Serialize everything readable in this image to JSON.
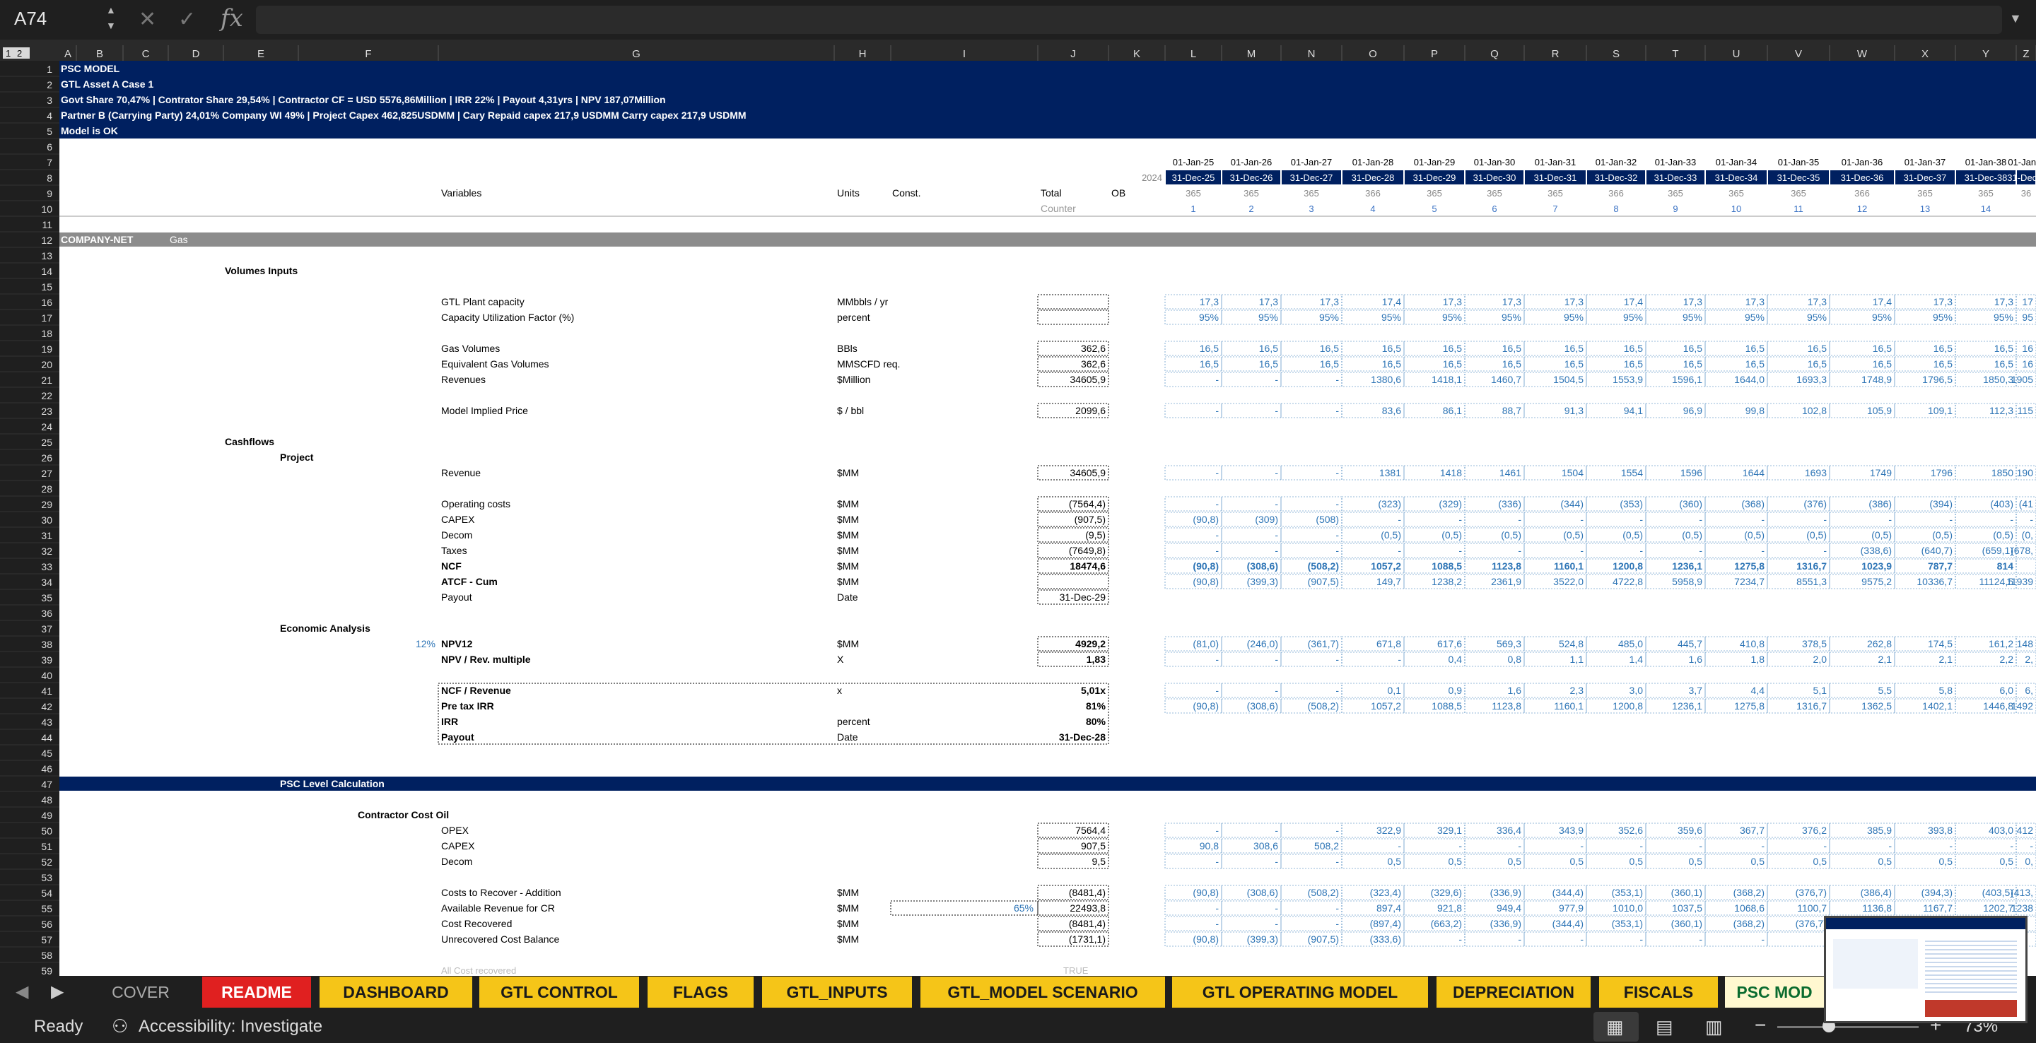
{
  "cell_ref": "A74",
  "formula": "",
  "outline_levels": [
    "1",
    "2"
  ],
  "columns": [
    "A",
    "B",
    "C",
    "D",
    "E",
    "F",
    "G",
    "H",
    "I",
    "J",
    "K",
    "L",
    "M",
    "N",
    "O",
    "P",
    "Q",
    "R",
    "S",
    "T",
    "U",
    "V",
    "W",
    "X",
    "Y",
    "Z"
  ],
  "banner": [
    "PSC MODEL",
    "GTL Asset A Case 1",
    "Govt Share 70,47% | Contrator Share 29,54% | Contractor CF = USD 5576,86Million | IRR 22% | Payout 4,31yrs | NPV 187,07Million",
    "Partner B (Carrying Party) 24,01% Company WI 49% | Project Capex 462,825USDMM | Cary Repaid capex 217,9 USDMM Carry capex 217,9 USDMM",
    "Model is OK"
  ],
  "headers": {
    "start_dates": [
      "01-Jan-25",
      "01-Jan-26",
      "01-Jan-27",
      "01-Jan-28",
      "01-Jan-29",
      "01-Jan-30",
      "01-Jan-31",
      "01-Jan-32",
      "01-Jan-33",
      "01-Jan-34",
      "01-Jan-35",
      "01-Jan-36",
      "01-Jan-37",
      "01-Jan-38",
      "01-Jan-3"
    ],
    "end_dates": [
      "31-Dec-25",
      "31-Dec-26",
      "31-Dec-27",
      "31-Dec-28",
      "31-Dec-29",
      "31-Dec-30",
      "31-Dec-31",
      "31-Dec-32",
      "31-Dec-33",
      "31-Dec-34",
      "31-Dec-35",
      "31-Dec-36",
      "31-Dec-37",
      "31-Dec-38",
      "31-Dec-3"
    ],
    "year_label": "2024",
    "days": [
      "365",
      "365",
      "365",
      "366",
      "365",
      "365",
      "365",
      "366",
      "365",
      "365",
      "365",
      "366",
      "365",
      "365",
      "36"
    ],
    "counter": [
      "1",
      "2",
      "3",
      "4",
      "5",
      "6",
      "7",
      "8",
      "9",
      "10",
      "11",
      "12",
      "13",
      "14",
      ""
    ],
    "variables": "Variables",
    "units": "Units",
    "const": "Const.",
    "total": "Total",
    "ob": "OB",
    "counter_label": "Counter"
  },
  "section": {
    "left": "COMPANY-NET",
    "right": "Gas"
  },
  "labels": {
    "volumes_inputs": "Volumes Inputs",
    "cashflows": "Cashflows",
    "project": "Project",
    "economic_analysis": "Economic Analysis",
    "discount_rate": "12%",
    "psc_level": "PSC Level Calculation",
    "contractor_cost_oil": "Contractor Cost Oil",
    "cost_recovered_note": "All Cost recovered",
    "true_flag": "TRUE",
    "cr_pct": "65%"
  },
  "rows": [
    {
      "r": 16,
      "label": "GTL Plant capacity",
      "unit": "MMbbls / yr",
      "total": "",
      "vals": [
        "17,3",
        "17,3",
        "17,3",
        "17,4",
        "17,3",
        "17,3",
        "17,3",
        "17,4",
        "17,3",
        "17,3",
        "17,3",
        "17,4",
        "17,3",
        "17,3",
        "17"
      ]
    },
    {
      "r": 17,
      "label": "Capacity Utilization Factor (%)",
      "unit": "percent",
      "total": "",
      "vals": [
        "95%",
        "95%",
        "95%",
        "95%",
        "95%",
        "95%",
        "95%",
        "95%",
        "95%",
        "95%",
        "95%",
        "95%",
        "95%",
        "95%",
        "95"
      ]
    },
    {
      "r": 19,
      "label": "Gas Volumes",
      "unit": "BBls",
      "total": "362,6",
      "vals": [
        "16,5",
        "16,5",
        "16,5",
        "16,5",
        "16,5",
        "16,5",
        "16,5",
        "16,5",
        "16,5",
        "16,5",
        "16,5",
        "16,5",
        "16,5",
        "16,5",
        "16"
      ]
    },
    {
      "r": 20,
      "label": "Equivalent Gas Volumes",
      "unit": "MMSCFD req.",
      "total": "362,6",
      "vals": [
        "16,5",
        "16,5",
        "16,5",
        "16,5",
        "16,5",
        "16,5",
        "16,5",
        "16,5",
        "16,5",
        "16,5",
        "16,5",
        "16,5",
        "16,5",
        "16,5",
        "16"
      ]
    },
    {
      "r": 21,
      "label": "Revenues",
      "unit": "$Million",
      "total": "34605,9",
      "vals": [
        "-",
        "-",
        "-",
        "1380,6",
        "1418,1",
        "1460,7",
        "1504,5",
        "1553,9",
        "1596,1",
        "1644,0",
        "1693,3",
        "1748,9",
        "1796,5",
        "1850,3",
        "1905"
      ]
    },
    {
      "r": 23,
      "label": "Model Implied Price",
      "unit": "$ / bbl",
      "total": "2099,6",
      "vals": [
        "-",
        "-",
        "-",
        "83,6",
        "86,1",
        "88,7",
        "91,3",
        "94,1",
        "96,9",
        "99,8",
        "102,8",
        "105,9",
        "109,1",
        "112,3",
        "115"
      ]
    },
    {
      "r": 27,
      "label": "Revenue",
      "unit": "$MM",
      "total": "34605,9",
      "vals": [
        "-",
        "-",
        "-",
        "1381",
        "1418",
        "1461",
        "1504",
        "1554",
        "1596",
        "1644",
        "1693",
        "1749",
        "1796",
        "1850",
        "190"
      ]
    },
    {
      "r": 29,
      "label": "Operating costs",
      "unit": "$MM",
      "total": "(7564,4)",
      "vals": [
        "-",
        "-",
        "-",
        "(323)",
        "(329)",
        "(336)",
        "(344)",
        "(353)",
        "(360)",
        "(368)",
        "(376)",
        "(386)",
        "(394)",
        "(403)",
        "(41"
      ]
    },
    {
      "r": 30,
      "label": "CAPEX",
      "unit": "$MM",
      "total": "(907,5)",
      "vals": [
        "(90,8)",
        "(309)",
        "(508)",
        "-",
        "-",
        "-",
        "-",
        "-",
        "-",
        "-",
        "-",
        "-",
        "-",
        "-",
        "-"
      ]
    },
    {
      "r": 31,
      "label": "Decom",
      "unit": "$MM",
      "total": "(9,5)",
      "vals": [
        "-",
        "-",
        "-",
        "(0,5)",
        "(0,5)",
        "(0,5)",
        "(0,5)",
        "(0,5)",
        "(0,5)",
        "(0,5)",
        "(0,5)",
        "(0,5)",
        "(0,5)",
        "(0,5)",
        "(0,"
      ]
    },
    {
      "r": 32,
      "label": "Taxes",
      "unit": "$MM",
      "total": "(7649,8)",
      "vals": [
        "-",
        "-",
        "-",
        "-",
        "-",
        "-",
        "-",
        "-",
        "-",
        "-",
        "-",
        "(338,6)",
        "(640,7)",
        "(659,1)",
        "(678,"
      ]
    },
    {
      "r": 33,
      "label": "NCF",
      "unit": "$MM",
      "total": "18474,6",
      "bold": true,
      "vals": [
        "(90,8)",
        "(308,6)",
        "(508,2)",
        "1057,2",
        "1088,5",
        "1123,8",
        "1160,1",
        "1200,8",
        "1236,1",
        "1275,8",
        "1316,7",
        "1023,9",
        "787,7",
        "814"
      ]
    },
    {
      "r": 34,
      "label": "ATCF - Cum",
      "unit": "$MM",
      "total": "",
      "bold": true,
      "vals": [
        "(90,8)",
        "(399,3)",
        "(907,5)",
        "149,7",
        "1238,2",
        "2361,9",
        "3522,0",
        "4722,8",
        "5958,9",
        "7234,7",
        "8551,3",
        "9575,2",
        "10336,7",
        "11124,5",
        "11939"
      ]
    },
    {
      "r": 35,
      "label": "Payout",
      "unit": "Date",
      "total": "31-Dec-29",
      "vals": []
    },
    {
      "r": 38,
      "label": "NPV12",
      "unit": "$MM",
      "total": "4929,2",
      "bold": true,
      "vals": [
        "(81,0)",
        "(246,0)",
        "(361,7)",
        "671,8",
        "617,6",
        "569,3",
        "524,8",
        "485,0",
        "445,7",
        "410,8",
        "378,5",
        "262,8",
        "174,5",
        "161,2",
        "148"
      ]
    },
    {
      "r": 39,
      "label": "NPV / Rev. multiple",
      "unit": "X",
      "total": "1,83",
      "bold": true,
      "vals": [
        "-",
        "-",
        "-",
        "-",
        "0,4",
        "0,8",
        "1,1",
        "1,4",
        "1,6",
        "1,8",
        "2,0",
        "2,1",
        "2,1",
        "2,2",
        "2,"
      ]
    },
    {
      "r": 41,
      "label": "NCF / Revenue",
      "unit": "x",
      "total": "5,01x",
      "bold": true,
      "vals": [
        "-",
        "-",
        "-",
        "0,1",
        "0,9",
        "1,6",
        "2,3",
        "3,0",
        "3,7",
        "4,4",
        "5,1",
        "5,5",
        "5,8",
        "6,0",
        "6,"
      ]
    },
    {
      "r": 42,
      "label": "Pre tax IRR",
      "unit": "",
      "total": "81%",
      "bold": true,
      "vals": [
        "(90,8)",
        "(308,6)",
        "(508,2)",
        "1057,2",
        "1088,5",
        "1123,8",
        "1160,1",
        "1200,8",
        "1236,1",
        "1275,8",
        "1316,7",
        "1362,5",
        "1402,1",
        "1446,8",
        "1492"
      ]
    },
    {
      "r": 43,
      "label": "IRR",
      "unit": "percent",
      "total": "80%",
      "bold": true,
      "vals": []
    },
    {
      "r": 44,
      "label": "Payout",
      "unit": "Date",
      "total": "31-Dec-28",
      "bold": true,
      "vals": []
    },
    {
      "r": 50,
      "label": "OPEX",
      "unit": "",
      "total": "7564,4",
      "vals": [
        "-",
        "-",
        "-",
        "322,9",
        "329,1",
        "336,4",
        "343,9",
        "352,6",
        "359,6",
        "367,7",
        "376,2",
        "385,9",
        "393,8",
        "403,0",
        "412"
      ]
    },
    {
      "r": 51,
      "label": "CAPEX",
      "unit": "",
      "total": "907,5",
      "vals": [
        "90,8",
        "308,6",
        "508,2",
        "-",
        "-",
        "-",
        "-",
        "-",
        "-",
        "-",
        "-",
        "-",
        "-",
        "-",
        "-"
      ]
    },
    {
      "r": 52,
      "label": "Decom",
      "unit": "",
      "total": "9,5",
      "vals": [
        "-",
        "-",
        "-",
        "0,5",
        "0,5",
        "0,5",
        "0,5",
        "0,5",
        "0,5",
        "0,5",
        "0,5",
        "0,5",
        "0,5",
        "0,5",
        "0,"
      ]
    },
    {
      "r": 54,
      "label": "Costs to Recover - Addition",
      "unit": "$MM",
      "total": "(8481,4)",
      "vals": [
        "(90,8)",
        "(308,6)",
        "(508,2)",
        "(323,4)",
        "(329,6)",
        "(336,9)",
        "(344,4)",
        "(353,1)",
        "(360,1)",
        "(368,2)",
        "(376,7)",
        "(386,4)",
        "(394,3)",
        "(403,5)",
        "(413,"
      ]
    },
    {
      "r": 55,
      "label": "Available Revenue for CR",
      "unit": "$MM",
      "total": "22493,8",
      "vals": [
        "-",
        "-",
        "-",
        "897,4",
        "921,8",
        "949,4",
        "977,9",
        "1010,0",
        "1037,5",
        "1068,6",
        "1100,7",
        "1136,8",
        "1167,7",
        "1202,7",
        "1238"
      ]
    },
    {
      "r": 56,
      "label": "Cost Recovered",
      "unit": "$MM",
      "total": "(8481,4)",
      "vals": [
        "-",
        "-",
        "-",
        "(897,4)",
        "(663,2)",
        "(336,9)",
        "(344,4)",
        "(353,1)",
        "(360,1)",
        "(368,2)",
        "(376,7)",
        "",
        "",
        "",
        ""
      ]
    },
    {
      "r": 57,
      "label": "Unrecovered Cost Balance",
      "unit": "$MM",
      "total": "(1731,1)",
      "vals": [
        "(90,8)",
        "(399,3)",
        "(907,5)",
        "(333,6)",
        "-",
        "-",
        "-",
        "-",
        "-",
        "-",
        "-",
        "",
        "",
        "",
        ""
      ]
    }
  ],
  "tabs": [
    {
      "label": "COVER",
      "color": "#1f1f1f",
      "text": "#aaa"
    },
    {
      "label": "README",
      "color": "#e02020",
      "text": "#fff"
    },
    {
      "label": "DASHBOARD",
      "color": "#f5c518",
      "text": "#1a1a1a"
    },
    {
      "label": "GTL CONTROL",
      "color": "#f5c518",
      "text": "#1a1a1a"
    },
    {
      "label": "FLAGS",
      "color": "#f5c518",
      "text": "#1a1a1a"
    },
    {
      "label": "GTL_INPUTS",
      "color": "#f5c518",
      "text": "#1a1a1a"
    },
    {
      "label": "GTL_MODEL SCENARIO",
      "color": "#f5c518",
      "text": "#1a1a1a"
    },
    {
      "label": "GTL OPERATING MODEL",
      "color": "#f5c518",
      "text": "#1a1a1a"
    },
    {
      "label": "DEPRECIATION",
      "color": "#f5c518",
      "text": "#1a1a1a"
    },
    {
      "label": "FISCALS",
      "color": "#f5c518",
      "text": "#1a1a1a"
    },
    {
      "label": "PSC MOD",
      "color": "#fff8d0",
      "text": "#0a6b2f"
    }
  ],
  "status": {
    "ready": "Ready",
    "accessibility": "Accessibility: Investigate",
    "zoom": "73%"
  },
  "colors": {
    "navy": "#002060",
    "blue_value": "#2e75b6",
    "section_grey": "#8c8c8c",
    "tab_yellow": "#f5c518",
    "tab_red": "#e02020"
  }
}
